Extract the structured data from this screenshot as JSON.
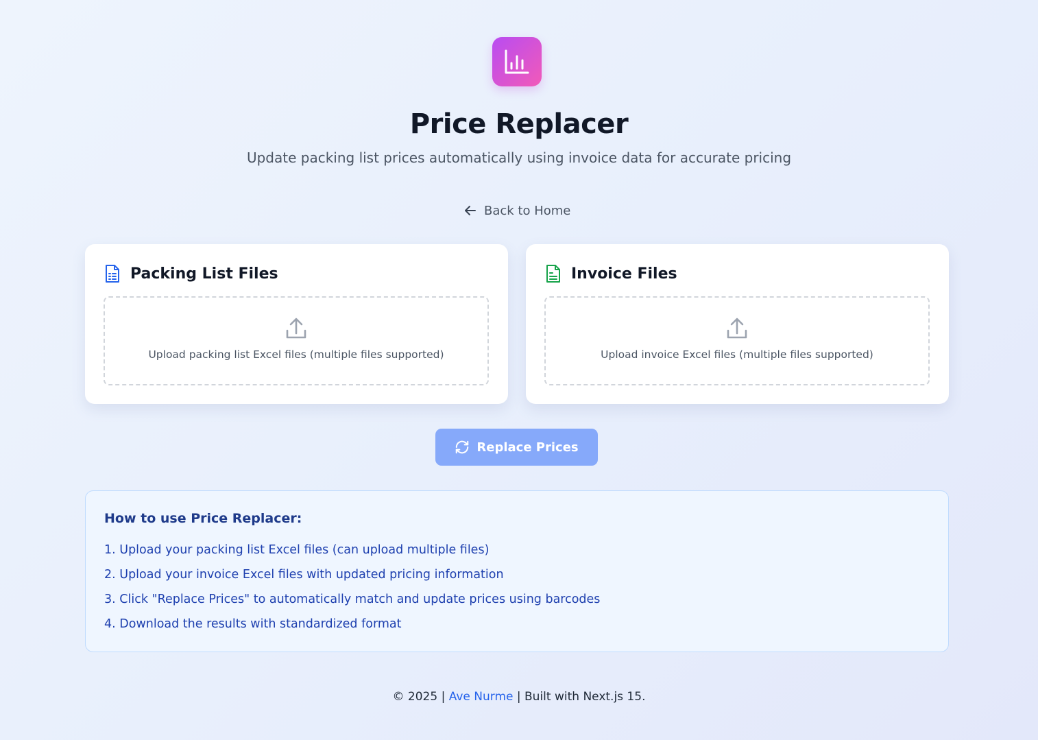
{
  "header": {
    "logo_icon": "bar-chart-icon",
    "title": "Price Replacer",
    "subtitle": "Update packing list prices automatically using invoice data for accurate pricing"
  },
  "nav": {
    "back_icon": "arrow-left-icon",
    "back_label": "Back to Home"
  },
  "packing_card": {
    "icon": "file-spreadsheet-icon",
    "icon_color": "#2563eb",
    "title": "Packing List Files",
    "upload_icon": "upload-icon",
    "upload_text": "Upload packing list Excel files (multiple files supported)"
  },
  "invoice_card": {
    "icon": "file-text-icon",
    "icon_color": "#16a34a",
    "title": "Invoice Files",
    "upload_icon": "upload-icon",
    "upload_text": "Upload invoice Excel files (multiple files supported)"
  },
  "action": {
    "icon": "refresh-icon",
    "label": "Replace Prices",
    "color": "#86a9fa"
  },
  "howto": {
    "title": "How to use Price Replacer:",
    "steps": [
      "1. Upload your packing list Excel files (can upload multiple files)",
      "2. Upload your invoice Excel files with updated pricing information",
      "3. Click \"Replace Prices\" to automatically match and update prices using barcodes",
      "4. Download the results with standardized format"
    ]
  },
  "footer": {
    "prefix": "© 2025 |",
    "author": "Ave Nurme",
    "suffix": "| Built with Next.js 15."
  },
  "colors": {
    "logo_gradient_start": "#b84cf2",
    "logo_gradient_end": "#f25ab8",
    "link": "#2563eb",
    "howto_text": "#1e40af"
  }
}
